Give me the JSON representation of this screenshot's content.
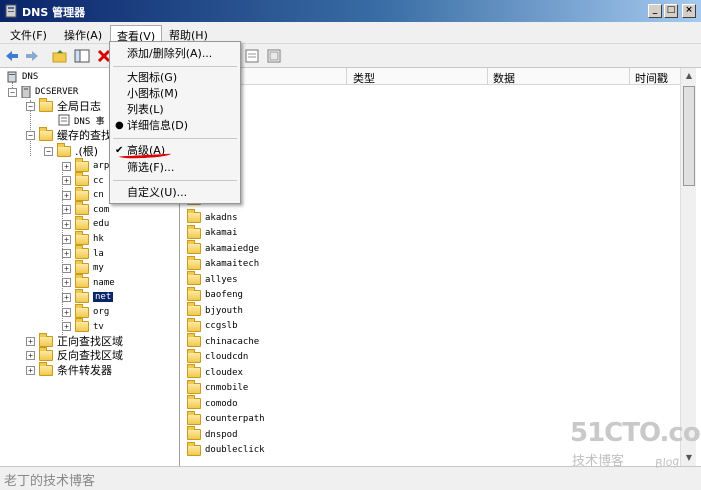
{
  "window": {
    "title": "DNS 管理器",
    "controls": {
      "minimize": "_",
      "maximize": "□",
      "close": "×"
    }
  },
  "menubar": [
    {
      "label": "文件(F)"
    },
    {
      "label": "操作(A)"
    },
    {
      "label": "查看(V)"
    },
    {
      "label": "帮助(H)"
    }
  ],
  "view_menu": {
    "items": [
      {
        "label": "添加/删除列(A)...",
        "checked": false
      },
      {
        "label": "大图标(G)",
        "checked": false
      },
      {
        "label": "小图标(M)",
        "checked": false
      },
      {
        "label": "列表(L)",
        "checked": false
      },
      {
        "label": "详细信息(D)",
        "checked": false,
        "radio": "●"
      },
      {
        "label": "高级(A)",
        "checked": true,
        "check": "✔"
      },
      {
        "label": "筛选(F)...",
        "checked": false
      },
      {
        "label": "自定义(U)...",
        "checked": false
      }
    ]
  },
  "tree": {
    "root": "DNS",
    "server": "DCSERVER",
    "global_logs": "全局日志",
    "dns_events": "DNS 事",
    "cached_lookups": "缓存的查找",
    "root_hint": ".(根)",
    "tlds": [
      "arpa",
      "cc",
      "cn",
      "com",
      "edu",
      "hk",
      "la",
      "my",
      "name",
      "net",
      "org",
      "tv"
    ],
    "selected_tld": "net",
    "forward_zones": "正向查找区域",
    "reverse_zones": "反向查找区域",
    "conditional_forwarders": "条件转发器"
  },
  "list": {
    "columns": [
      "类型",
      "数据",
      "时间戳"
    ],
    "items": [
      "akadns",
      "akamai",
      "akamaiedge",
      "akamaitech",
      "allyes",
      "baofeng",
      "bjyouth",
      "ccgslb",
      "chinacache",
      "cloudcdn",
      "cloudex",
      "cnmobile",
      "comodo",
      "counterpath",
      "dnspod",
      "doubleclick"
    ]
  },
  "status": {
    "text": "老丁的技术博客"
  },
  "watermark": {
    "brand": "51CTO.com",
    "sub": "技术博客",
    "blog": "Blog"
  }
}
